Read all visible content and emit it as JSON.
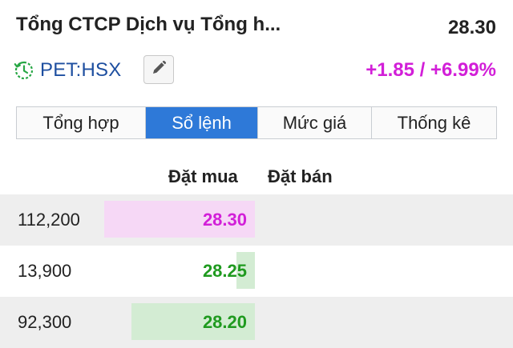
{
  "header": {
    "title": "Tổng CTCP Dịch vụ Tổng h...",
    "price": "28.30",
    "ticker": "PET:HSX",
    "change": "+1.85 / +6.99%",
    "change_color": "#d21fd8"
  },
  "tabs": [
    {
      "label": "Tổng hợp",
      "active": false
    },
    {
      "label": "Sổ lệnh",
      "active": true
    },
    {
      "label": "Mức giá",
      "active": false
    },
    {
      "label": "Thống kê",
      "active": false
    }
  ],
  "orderbook": {
    "col_buy": "Đặt mua",
    "col_sell": "Đặt bán",
    "rows": [
      {
        "volume": "112,200",
        "bid": "28.30",
        "bid_color": "#d21fd8",
        "bar_color": "#f6d8f6",
        "bar_fraction": 1.0
      },
      {
        "volume": "13,900",
        "bid": "28.25",
        "bid_color": "#1f9a1f",
        "bar_color": "#d3ecd3",
        "bar_fraction": 0.12
      },
      {
        "volume": "92,300",
        "bid": "28.20",
        "bid_color": "#1f9a1f",
        "bar_color": "#d3ecd3",
        "bar_fraction": 0.82
      }
    ]
  },
  "icons": {
    "clock": "clock-icon",
    "edit": "pencil-icon"
  }
}
